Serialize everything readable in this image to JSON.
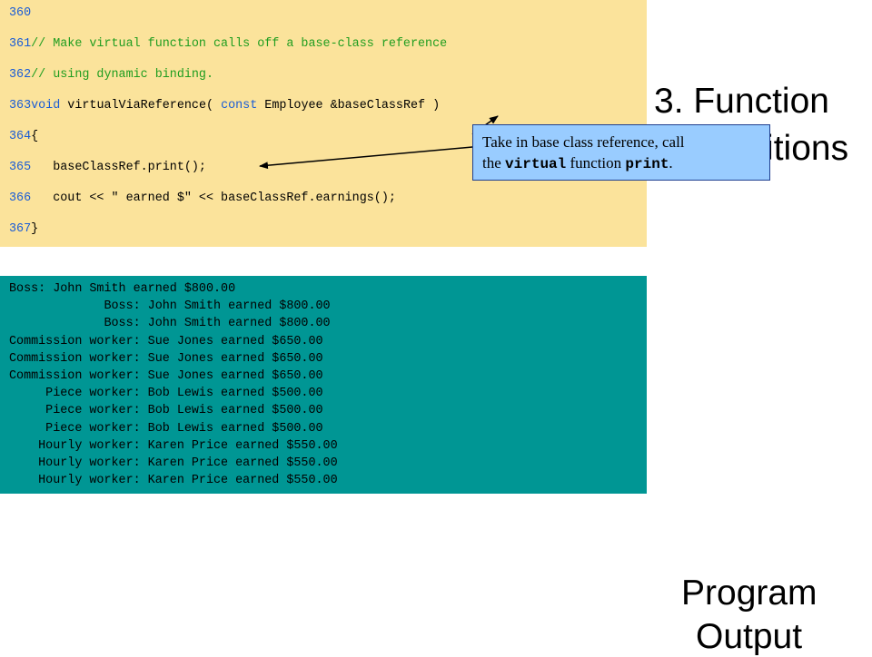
{
  "code_lines": [
    [
      {
        "t": "360",
        "c": "ln"
      }
    ],
    [
      {
        "t": "361",
        "c": "ln"
      },
      {
        "t": "// Make virtual function calls off a base-class reference",
        "c": "cm"
      }
    ],
    [
      {
        "t": "362",
        "c": "ln"
      },
      {
        "t": "// using dynamic binding.",
        "c": "cm"
      }
    ],
    [
      {
        "t": "363",
        "c": "ln"
      },
      {
        "t": "void",
        "c": "kw"
      },
      {
        "t": " virtualViaReference( ",
        "c": "tx"
      },
      {
        "t": "const",
        "c": "kw"
      },
      {
        "t": " Employee &baseClassRef )",
        "c": "tx"
      }
    ],
    [
      {
        "t": "364",
        "c": "ln"
      },
      {
        "t": "{",
        "c": "tx"
      }
    ],
    [
      {
        "t": "365",
        "c": "ln"
      },
      {
        "t": "   baseClassRef.print();",
        "c": "tx"
      }
    ],
    [
      {
        "t": "366",
        "c": "ln"
      },
      {
        "t": "   cout << \" earned $\" << baseClassRef.earnings();",
        "c": "tx"
      }
    ],
    [
      {
        "t": "367",
        "c": "ln"
      },
      {
        "t": "}",
        "c": "tx"
      }
    ]
  ],
  "output_lines": [
    "Boss: John Smith earned $800.00",
    "             Boss: John Smith earned $800.00",
    "             Boss: John Smith earned $800.00",
    "Commission worker: Sue Jones earned $650.00",
    "Commission worker: Sue Jones earned $650.00",
    "Commission worker: Sue Jones earned $650.00",
    "     Piece worker: Bob Lewis earned $500.00",
    "     Piece worker: Bob Lewis earned $500.00",
    "     Piece worker: Bob Lewis earned $500.00",
    "    Hourly worker: Karen Price earned $550.00",
    "    Hourly worker: Karen Price earned $550.00",
    "    Hourly worker: Karen Price earned $550.00"
  ],
  "side": {
    "title_line1": "3.  Function",
    "title_line2": "Definitions",
    "program_line1": "Program",
    "program_line2": "Output"
  },
  "callout": {
    "text1": "Take in base class reference, call",
    "text2": "the ",
    "code1": "virtual",
    "text3": " function ",
    "code2": "print",
    "text4": "."
  },
  "colors": {
    "code_bg": "#fbe39b",
    "output_bg": "#009694",
    "callout_bg": "#99ccff",
    "line_number": "#1a5cd6",
    "comment": "#1f9d1f"
  }
}
